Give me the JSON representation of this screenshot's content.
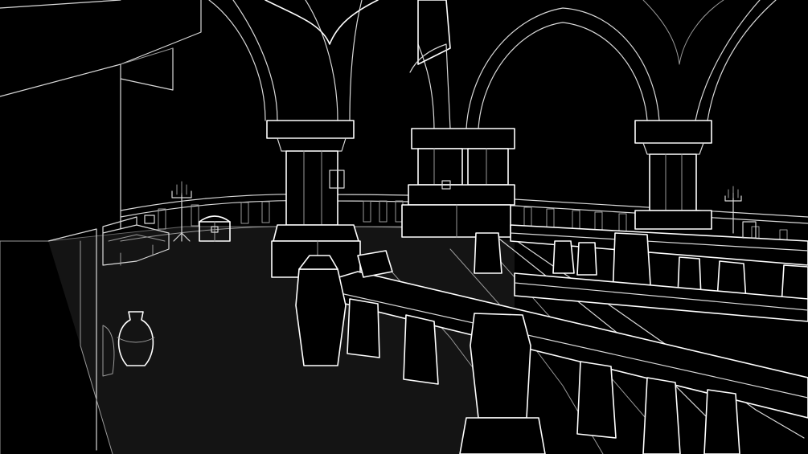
{
  "scene": {
    "name": "gothic-balcony-wireframe",
    "palette": {
      "background": "#000000",
      "line_bright": "#ffffff",
      "line_mid": "#d9d9d9",
      "line_dim": "#9a9a9a",
      "line_faint": "#6a6a6a",
      "floor_glow": "#141414"
    }
  }
}
